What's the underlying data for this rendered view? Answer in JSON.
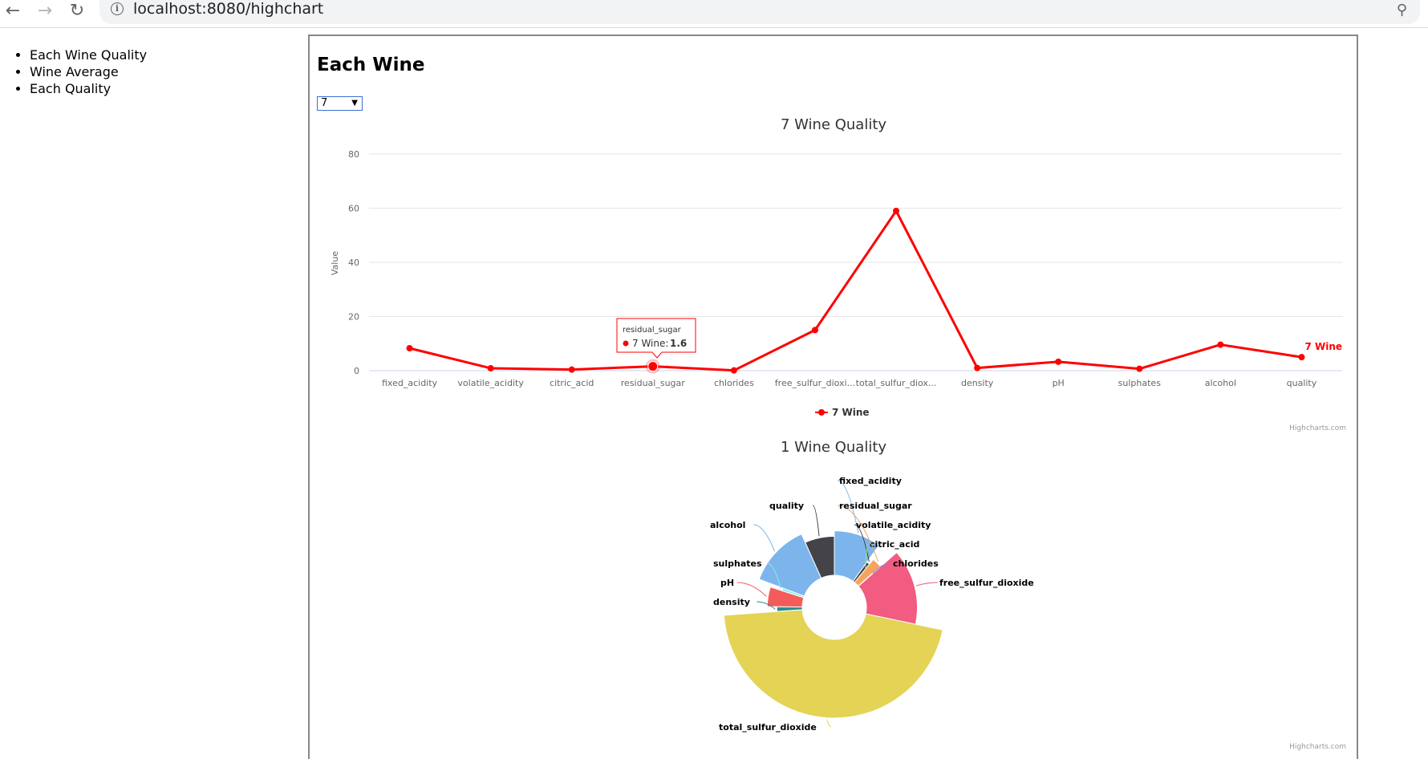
{
  "browser": {
    "url": "localhost:8080/highchart",
    "back_icon": "arrow-left-icon",
    "forward_icon": "arrow-right-icon",
    "reload_icon": "reload-icon",
    "info_icon": "info-icon",
    "zoom_icon": "zoom-icon"
  },
  "sidebar": {
    "items": [
      {
        "label": "Each Wine Quality"
      },
      {
        "label": "Wine Average"
      },
      {
        "label": "Each Quality"
      }
    ]
  },
  "main": {
    "title": "Each Wine",
    "select": {
      "selected": "7"
    }
  },
  "credits": "Highcharts.com",
  "tooltip": {
    "category": "residual_sugar",
    "series": "7 Wine",
    "value": "1.6"
  },
  "colors": {
    "line": "#ff0000",
    "tooltip_border": "#ff0000"
  },
  "chart_data": [
    {
      "type": "line",
      "title": "7 Wine Quality",
      "ylabel": "Value",
      "xlabel": "",
      "ylim": [
        0,
        80
      ],
      "yticks": [
        0,
        20,
        40,
        60,
        80
      ],
      "grid": true,
      "legend_position": "bottom-center",
      "categories": [
        "fixed_acidity",
        "volatile_acidity",
        "citric_acid",
        "residual_sugar",
        "chlorides",
        "free_sulfur_dioxide",
        "total_sulfur_dioxide",
        "density",
        "pH",
        "sulphates",
        "alcohol",
        "quality"
      ],
      "category_labels": [
        "fixed_acidity",
        "volatile_acidity",
        "citric_acid",
        "residual_sugar",
        "chlorides",
        "free_sulfur_dioxi...",
        "total_sulfur_diox...",
        "density",
        "pH",
        "sulphates",
        "alcohol",
        "quality"
      ],
      "series": [
        {
          "name": "7 Wine",
          "color": "#ff0000",
          "values": [
            8.3,
            0.9,
            0.4,
            1.6,
            0.1,
            15,
            59,
            1.0,
            3.3,
            0.7,
            9.6,
            5
          ]
        }
      ]
    },
    {
      "type": "pie",
      "subtype": "variable-radius-donut",
      "title": "1 Wine Quality",
      "slices": [
        {
          "label": "fixed_acidity",
          "value": 7.4,
          "color": "#7cb5ec"
        },
        {
          "label": "volatile_acidity",
          "value": 0.7,
          "color": "#434348"
        },
        {
          "label": "citric_acid",
          "value": 0.0,
          "color": "#90ed7d"
        },
        {
          "label": "residual_sugar",
          "value": 1.9,
          "color": "#f7a35c"
        },
        {
          "label": "chlorides",
          "value": 0.08,
          "color": "#8085e9"
        },
        {
          "label": "free_sulfur_dioxide",
          "value": 11,
          "color": "#f15c80"
        },
        {
          "label": "total_sulfur_dioxide",
          "value": 34,
          "color": "#e4d354"
        },
        {
          "label": "density",
          "value": 1.0,
          "color": "#2b908f"
        },
        {
          "label": "pH",
          "value": 3.5,
          "color": "#f45b5b"
        },
        {
          "label": "sulphates",
          "value": 0.6,
          "color": "#91e8e1"
        },
        {
          "label": "alcohol",
          "value": 9.4,
          "color": "#7cb5ec"
        },
        {
          "label": "quality",
          "value": 5,
          "color": "#434348"
        }
      ]
    }
  ]
}
